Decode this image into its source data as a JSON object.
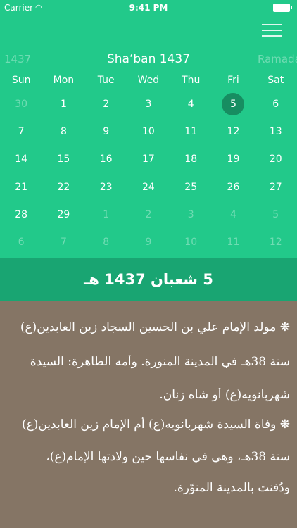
{
  "status_bar": {
    "carrier": "Carrier",
    "time": "9:41 PM"
  },
  "header": {
    "menu_icon": "hamburger-menu-icon",
    "prev_month": "1437",
    "title": "Sha‘ban 1437",
    "next_month": "Ramada"
  },
  "weekdays": [
    "Sun",
    "Mon",
    "Tue",
    "Wed",
    "Thu",
    "Fri",
    "Sat"
  ],
  "calendar": {
    "selected_day": "5",
    "weeks": [
      [
        "30",
        "1",
        "2",
        "3",
        "4",
        "5",
        "6"
      ],
      [
        "7",
        "8",
        "9",
        "10",
        "11",
        "12",
        "13"
      ],
      [
        "14",
        "15",
        "16",
        "17",
        "18",
        "19",
        "20"
      ],
      [
        "21",
        "22",
        "23",
        "24",
        "25",
        "26",
        "27"
      ],
      [
        "28",
        "29",
        "1",
        "2",
        "3",
        "4",
        "5"
      ],
      [
        "6",
        "7",
        "8",
        "9",
        "10",
        "11",
        "12"
      ]
    ],
    "muted": [
      [
        true,
        false,
        false,
        false,
        false,
        false,
        false
      ],
      [
        false,
        false,
        false,
        false,
        false,
        false,
        false
      ],
      [
        false,
        false,
        false,
        false,
        false,
        false,
        false
      ],
      [
        false,
        false,
        false,
        false,
        false,
        false,
        false
      ],
      [
        false,
        false,
        true,
        true,
        true,
        true,
        true
      ],
      [
        true,
        true,
        true,
        true,
        true,
        true,
        true
      ]
    ]
  },
  "selected_date_label": "5 شعبان 1437 هـ",
  "notes": [
    "❋ مولد الإمام علي بن الحسين السجاد زين العابدين(ع)",
    "سنة 38هـ في المدينة المنورة. وأمه الطاهرة: السيدة",
    "شهربانويه(ع) أو شاه زنان.",
    "❋ وفاة السيدة شهربانويه(ع) أُم الإمام زين العابدين(ع)",
    "سنة 38هـ، وهي في نفاسها حين ولادتها الإمام(ع)،",
    "ودُفنت بالمدينة المنوّرة."
  ],
  "colors": {
    "header_bg": "#22c98a",
    "selected_circle": "#178d61",
    "date_bar_bg": "#19a572",
    "notes_bg": "#857565"
  }
}
